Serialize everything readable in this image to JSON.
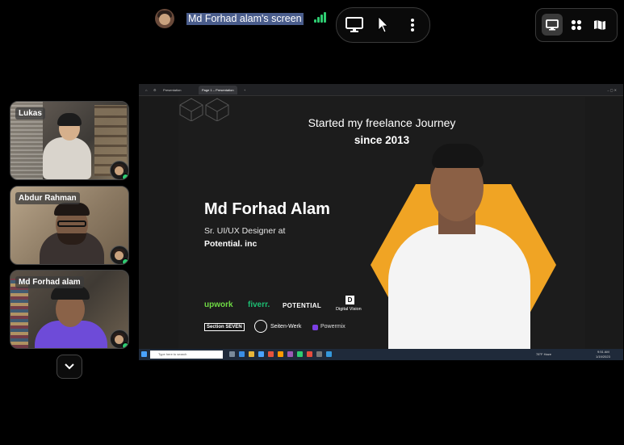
{
  "header": {
    "presenter_screen_label": "Md Forhad alam's screen",
    "signal_color": "#2ecc71"
  },
  "controls": {
    "share_screen_icon": "monitor-icon",
    "pointer_icon": "cursor-pointer-icon",
    "more_icon": "more-vertical-icon"
  },
  "view_modes": [
    {
      "icon": "presenter-view-icon",
      "active": true
    },
    {
      "icon": "grid-view-icon",
      "active": false
    },
    {
      "icon": "map-view-icon",
      "active": false
    }
  ],
  "participants": [
    {
      "name": "Lukas"
    },
    {
      "name": "Abdur Rahman"
    },
    {
      "name": "Md Forhad alam"
    }
  ],
  "shared_screen": {
    "browser_tabs": [
      "Presentation",
      "Page 1 – Presentation"
    ],
    "slide": {
      "headline_line1": "Started my freelance Journey",
      "headline_line2": "since 2013",
      "name": "Md Forhad Alam",
      "role_line1": "Sr. UI/UX Designer at",
      "role_line2": "Potential. inc",
      "logos_row1": [
        "upwork",
        "fiverr.",
        "POTENTIAL",
        "Digital Vision"
      ],
      "logos_row2": [
        "Section SEVEN",
        "Seiten-Werk",
        "Powermix"
      ],
      "digital_vision_letter": "D",
      "accent_color": "#f0a424"
    },
    "taskbar": {
      "search_placeholder": "Type here to search",
      "weather": "78°F  Haze",
      "clock_time": "9:51 AM",
      "clock_date": "1/19/2023"
    }
  }
}
